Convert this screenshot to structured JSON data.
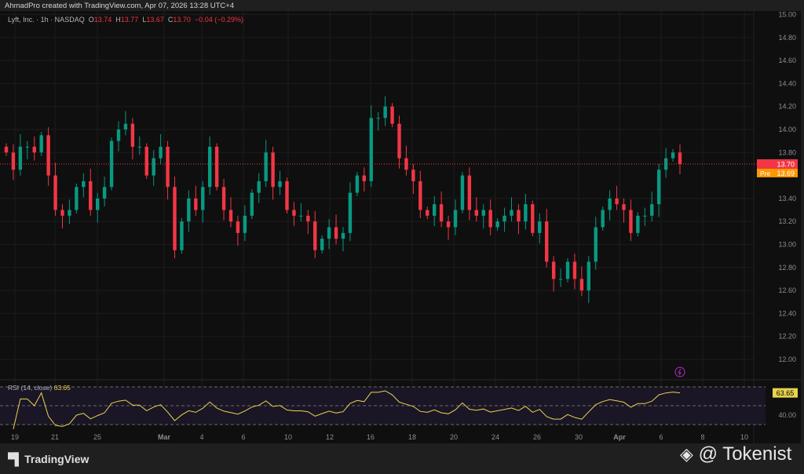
{
  "credit": "AhmadPro created with TradingView.com, Apr 07, 2026 13:28 UTC+4",
  "legend": {
    "symbol": "Lyft, Inc. · 1h · NASDAQ",
    "o_label": "O",
    "o": "13.74",
    "h_label": "H",
    "h": "13.77",
    "l_label": "L",
    "l": "13.67",
    "c_label": "C",
    "c": "13.70",
    "change": "−0.04 (−0.29%)"
  },
  "rsi_legend": {
    "label": "RSI (14, close)",
    "value": "63.65"
  },
  "badges": {
    "last": "13.70",
    "pre_label": "Pre",
    "pre": "13.69",
    "rsi": "63.65"
  },
  "footer": {
    "logo": "TradingView",
    "watermark": "@ Tokenist"
  },
  "colors": {
    "up": "#089981",
    "down": "#f23645",
    "rsi": "#e8d44d",
    "pre": "#ff9800"
  },
  "chart_data": {
    "type": "candlestick",
    "title": "Lyft, Inc. · 1h · NASDAQ",
    "ylim": [
      11.8,
      15.0
    ],
    "y_ticks": [
      "15.00",
      "14.80",
      "14.60",
      "14.40",
      "14.20",
      "14.00",
      "13.80",
      "13.40",
      "13.20",
      "13.00",
      "12.80",
      "12.60",
      "12.40",
      "12.20",
      "12.00"
    ],
    "x_ticks": [
      "19",
      "21",
      "25",
      "Mar",
      "4",
      "6",
      "10",
      "12",
      "16",
      "18",
      "20",
      "24",
      "26",
      "30",
      "Apr",
      "6",
      "8",
      "10"
    ],
    "closes": [
      13.8,
      13.65,
      13.85,
      13.85,
      13.8,
      13.95,
      13.6,
      13.3,
      13.25,
      13.3,
      13.5,
      13.55,
      13.3,
      13.4,
      13.5,
      13.9,
      14.0,
      14.05,
      13.85,
      13.85,
      13.6,
      13.75,
      13.85,
      13.5,
      12.95,
      13.2,
      13.4,
      13.3,
      13.5,
      13.85,
      13.5,
      13.3,
      13.2,
      13.1,
      13.25,
      13.45,
      13.55,
      13.8,
      13.5,
      13.55,
      13.3,
      13.25,
      13.25,
      13.2,
      12.95,
      13.05,
      13.15,
      13.05,
      13.1,
      13.45,
      13.6,
      13.55,
      14.1,
      14.1,
      14.2,
      14.05,
      13.75,
      13.65,
      13.55,
      13.3,
      13.25,
      13.35,
      13.2,
      13.15,
      13.3,
      13.6,
      13.3,
      13.25,
      13.3,
      13.15,
      13.2,
      13.25,
      13.3,
      13.2,
      13.35,
      13.1,
      13.2,
      12.85,
      12.7,
      12.7,
      12.85,
      12.7,
      12.6,
      12.85,
      13.15,
      13.3,
      13.4,
      13.35,
      13.3,
      13.1,
      13.25,
      13.25,
      13.35,
      13.65,
      13.75,
      13.8,
      13.7
    ],
    "rsi": {
      "period": 14,
      "levels": [
        70,
        50,
        30
      ],
      "y_ticks": [
        "40.00"
      ],
      "last": 63.65
    }
  }
}
